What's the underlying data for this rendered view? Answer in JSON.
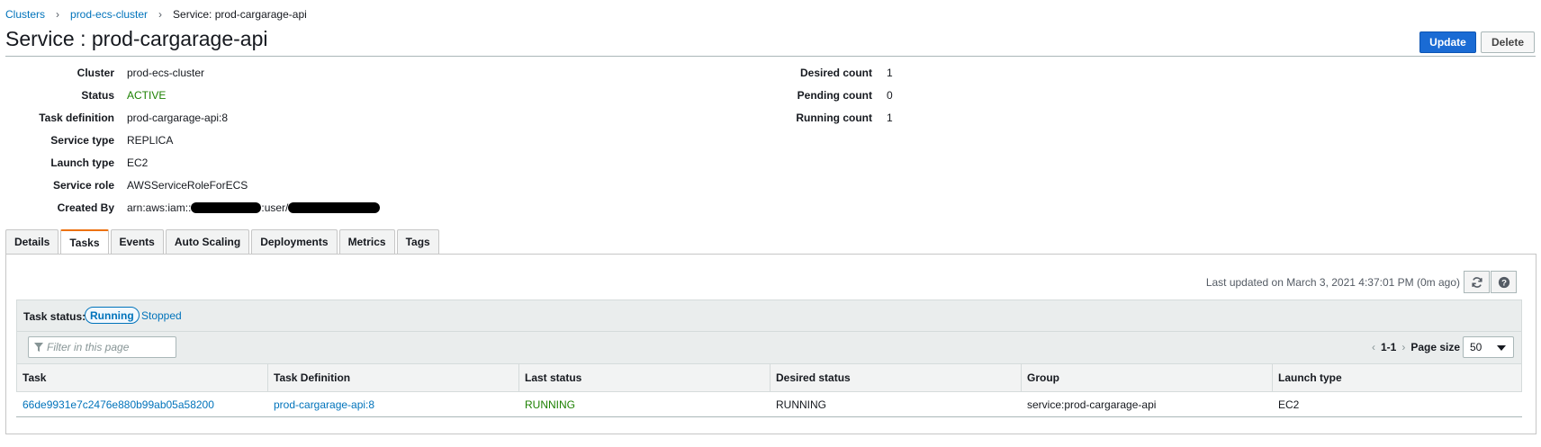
{
  "breadcrumb": {
    "clusters": "Clusters",
    "cluster": "prod-ecs-cluster",
    "current": "Service: prod-cargarage-api"
  },
  "page_title": "Service : prod-cargarage-api",
  "buttons": {
    "update": "Update",
    "delete": "Delete"
  },
  "details_left": {
    "cluster_label": "Cluster",
    "cluster_value": "prod-ecs-cluster",
    "status_label": "Status",
    "status_value": "ACTIVE",
    "task_def_label": "Task definition",
    "task_def_value": "prod-cargarage-api:8",
    "service_type_label": "Service type",
    "service_type_value": "REPLICA",
    "launch_type_label": "Launch type",
    "launch_type_value": "EC2",
    "service_role_label": "Service role",
    "service_role_value": "AWSServiceRoleForECS",
    "created_by_label": "Created By",
    "created_by_prefix": "arn:aws:iam::",
    "created_by_mid": ":user/"
  },
  "details_right": {
    "desired_label": "Desired count",
    "desired_value": "1",
    "pending_label": "Pending count",
    "pending_value": "0",
    "running_label": "Running count",
    "running_value": "1"
  },
  "tabs": [
    "Details",
    "Tasks",
    "Events",
    "Auto Scaling",
    "Deployments",
    "Metrics",
    "Tags"
  ],
  "active_tab": "Tasks",
  "last_updated": "Last updated on March 3, 2021 4:37:01 PM (0m ago)",
  "task_status": {
    "label": "Task status:",
    "running": "Running",
    "stopped": "Stopped"
  },
  "filter_placeholder": "Filter in this page",
  "pagination": {
    "range": "1-1",
    "page_size_label": "Page size",
    "page_size": "50"
  },
  "table": {
    "columns": [
      "Task",
      "Task Definition",
      "Last status",
      "Desired status",
      "Group",
      "Launch type"
    ],
    "rows": [
      [
        "66de9931e7c2476e880b99ab05a58200",
        "prod-cargarage-api:8",
        "RUNNING",
        "RUNNING",
        "service:prod-cargarage-api",
        "EC2"
      ]
    ]
  },
  "colors": {
    "link": "#0073bb",
    "primary": "#1a6bd4",
    "success": "#1d8102",
    "active_tab": "#ec7211"
  },
  "icons": [
    "chevron-right-icon",
    "refresh-icon",
    "help-icon",
    "filter-icon",
    "caret-down-icon"
  ]
}
